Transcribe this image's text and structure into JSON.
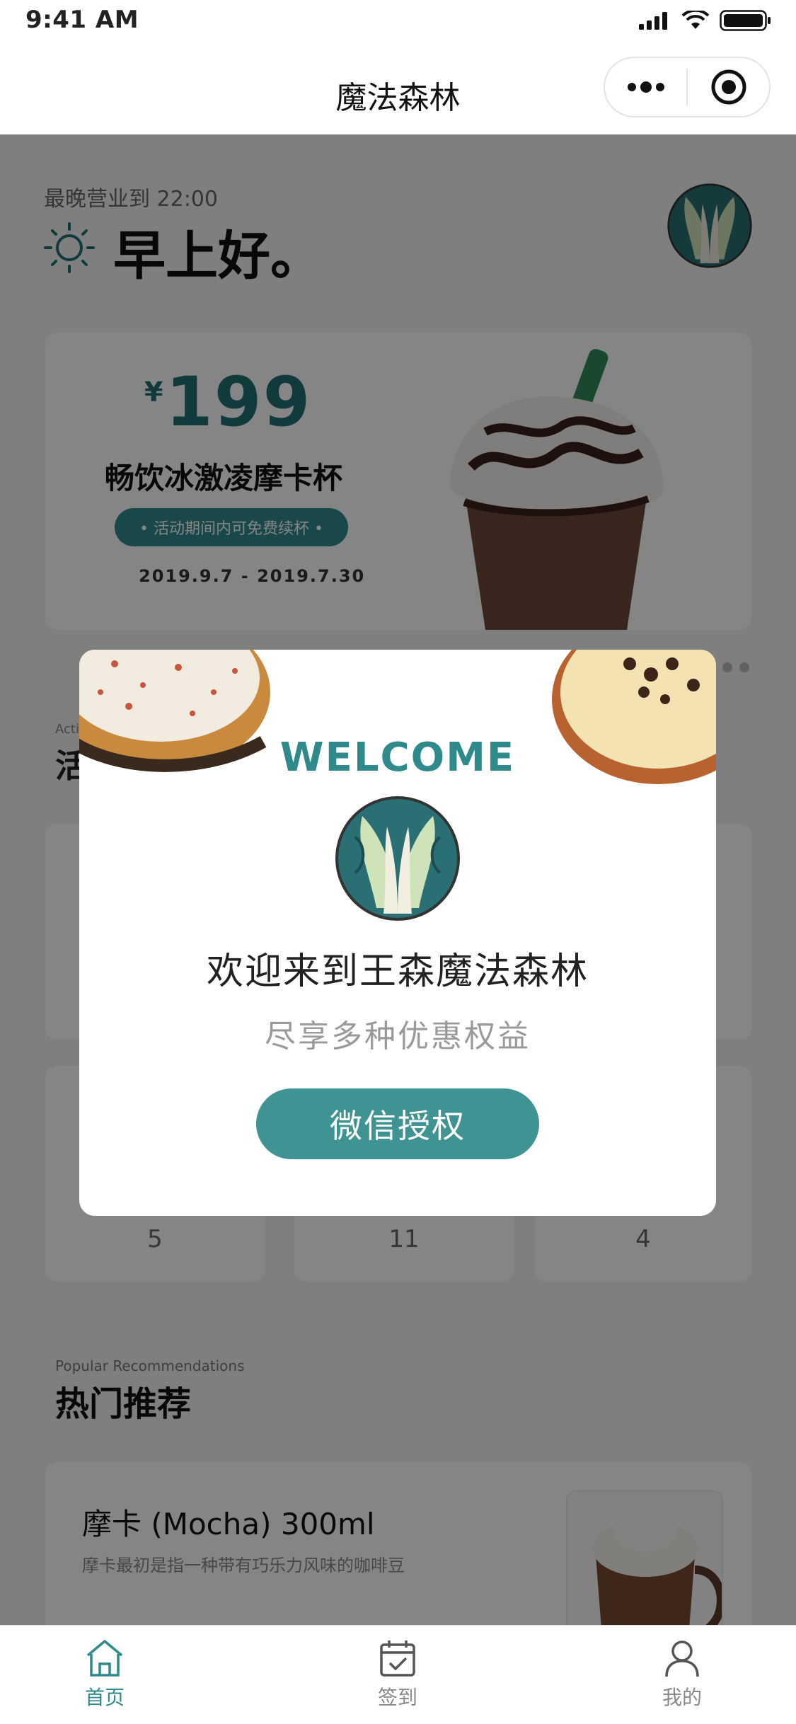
{
  "status_bar": {
    "time": "9:41 AM"
  },
  "nav": {
    "title": "魔法森林"
  },
  "header": {
    "hours": "最晚营业到 22:00",
    "greeting": "早上好。"
  },
  "promo": {
    "currency": "¥",
    "price": "199",
    "name": "畅饮冰激凌摩卡杯",
    "tag": "• 活动期间内可免费续杯 •",
    "date_range": "2019.9.7 - 2019.7.30"
  },
  "activity": {
    "subtitle": "Acti",
    "title": "活"
  },
  "activity_counts": [
    "5",
    "11",
    "4"
  ],
  "popular": {
    "subtitle": "Popular Recommendations",
    "title": "热门推荐"
  },
  "product": {
    "name": "摩卡 (Mocha) 300ml",
    "desc": "摩卡最初是指一种带有巧乐力风味的咖啡豆"
  },
  "modal": {
    "welcome": "WELCOME",
    "title": "欢迎来到王森魔法森林",
    "subtitle": "尽享多种优惠权益",
    "button": "微信授权"
  },
  "tabs": [
    {
      "label": "首页",
      "icon": "home-icon",
      "active": true
    },
    {
      "label": "签到",
      "icon": "calendar-check-icon",
      "active": false
    },
    {
      "label": "我的",
      "icon": "user-icon",
      "active": false
    }
  ],
  "colors": {
    "accent": "#3f9393",
    "brand_dark": "#1f6f73",
    "overlay": "rgba(0,0,0,0.48)"
  }
}
